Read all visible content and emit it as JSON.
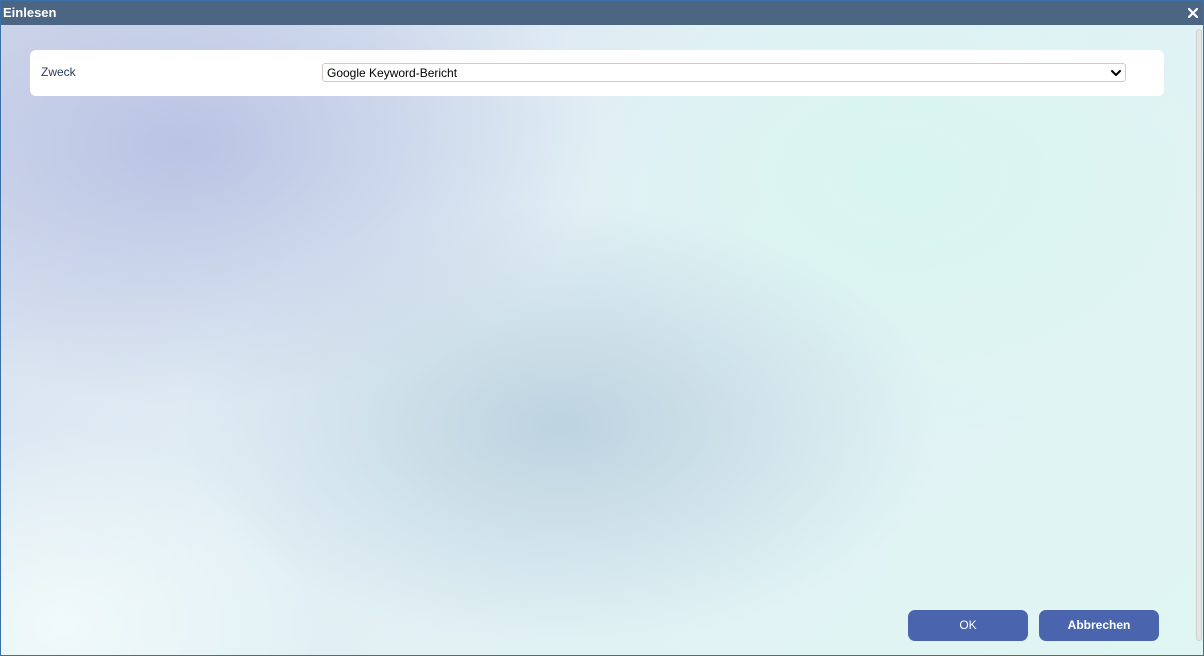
{
  "dialog": {
    "title": "Einlesen",
    "close_symbol": "✕"
  },
  "form": {
    "purpose_label": "Zweck",
    "purpose_select": {
      "selected": "Google Keyword-Bericht"
    }
  },
  "buttons": {
    "ok_label": "OK",
    "cancel_label": "Abbrechen"
  },
  "colors": {
    "titlebar": "#4b6583",
    "button": "#4a64ae",
    "label_text": "#2a3d5c"
  },
  "icons": {
    "close": "close-icon",
    "dropdown": "chevron-down-icon"
  }
}
